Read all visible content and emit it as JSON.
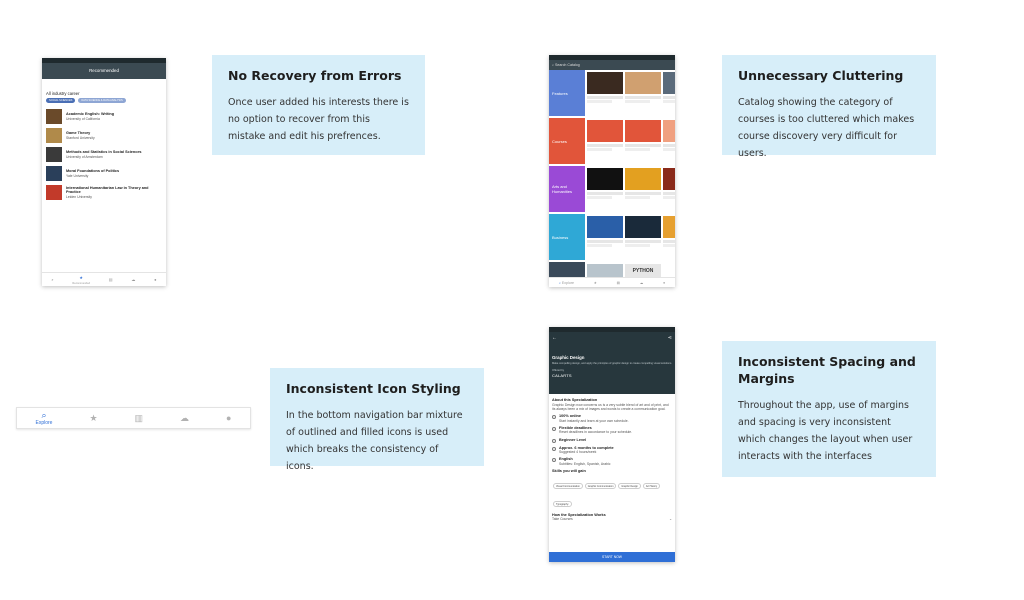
{
  "cards": {
    "errors": {
      "title": "No Recovery from Errors",
      "body": "Once user added his interests there is no option to recover from this mistake and edit his prefrences."
    },
    "clutter": {
      "title": "Unnecessary Cluttering",
      "body": "Catalog showing the category of courses is too cluttered which makes course discovery very difficult for users."
    },
    "icons": {
      "title": "Inconsistent Icon Styling",
      "body": "In the bottom navigation bar mixture of outlined and filled icons is used which breaks the consistency of icons."
    },
    "spacing": {
      "title": "Inconsistent Spacing and Margins",
      "body": "Throughout the app, use of margins and spacing is very inconsistent which changes the layout when user interacts with the interfaces"
    }
  },
  "phone1": {
    "header": "Recommended",
    "section": "All industry career",
    "chips": [
      "SOCIAL SCIENCES",
      "DATA SCIENCE & DATA ANALYSIS"
    ],
    "rows": [
      {
        "title": "Academic English: Writing",
        "sub": "University of California",
        "color": "#6a4a2a"
      },
      {
        "title": "Game Theory",
        "sub": "Stanford University",
        "color": "#b08a4a"
      },
      {
        "title": "Methods and Statistics in Social Sciences",
        "sub": "University of Amsterdam",
        "color": "#3a3a3a"
      },
      {
        "title": "Moral Foundations of Politics",
        "sub": "Yale University",
        "color": "#2a3f5a"
      },
      {
        "title": "International Humanitarian Law in Theory and Practice",
        "sub": "Leiden University",
        "color": "#c23a2a"
      }
    ],
    "nav": [
      "Q",
      "Recommended",
      "",
      "",
      ""
    ]
  },
  "phone2": {
    "search": "Search Catalog",
    "categories": [
      {
        "label": "Features",
        "color": "#5a7fd6"
      },
      {
        "label": "Courses",
        "color": "#e1553a"
      },
      {
        "label": "Arts and Humanities",
        "color": "#9a4ad6"
      },
      {
        "label": "Business",
        "color": "#2fa8d6"
      }
    ],
    "python": "PYTHON",
    "nav": "Explore"
  },
  "phone3": {
    "title": "Graphic Design",
    "desc": "Make compelling design, and apply the principles of graphic design to create compelling visual solutions.",
    "offered": "Offered by",
    "offeredBy": "CALARTS",
    "about": "About this Specialization",
    "aboutBody": "Graphic Design now concerns us is a very subtle blend of art and of print, and its always been a mix of images and words to create a communication goal.",
    "features": [
      {
        "t": "100% online",
        "s": "Start instantly and learn at your own schedule."
      },
      {
        "t": "Flexible deadlines",
        "s": "Reset deadlines in accordance to your schedule."
      },
      {
        "t": "Beginner Level",
        "s": ""
      },
      {
        "t": "Approx. 6 months to complete",
        "s": "Suggested 4 hours/week"
      },
      {
        "t": "English",
        "s": "Subtitles: English, Spanish, Arabic"
      }
    ],
    "skillsTitle": "Skills you will gain",
    "skills": [
      "Visual Communication",
      "Graphic Communication",
      "Graphic Design",
      "Art History",
      "Typography"
    ],
    "works": "How the Specialization Works",
    "take": "Take Courses",
    "cta": "START NOW"
  },
  "navstrip": {
    "explore": "Explore"
  }
}
